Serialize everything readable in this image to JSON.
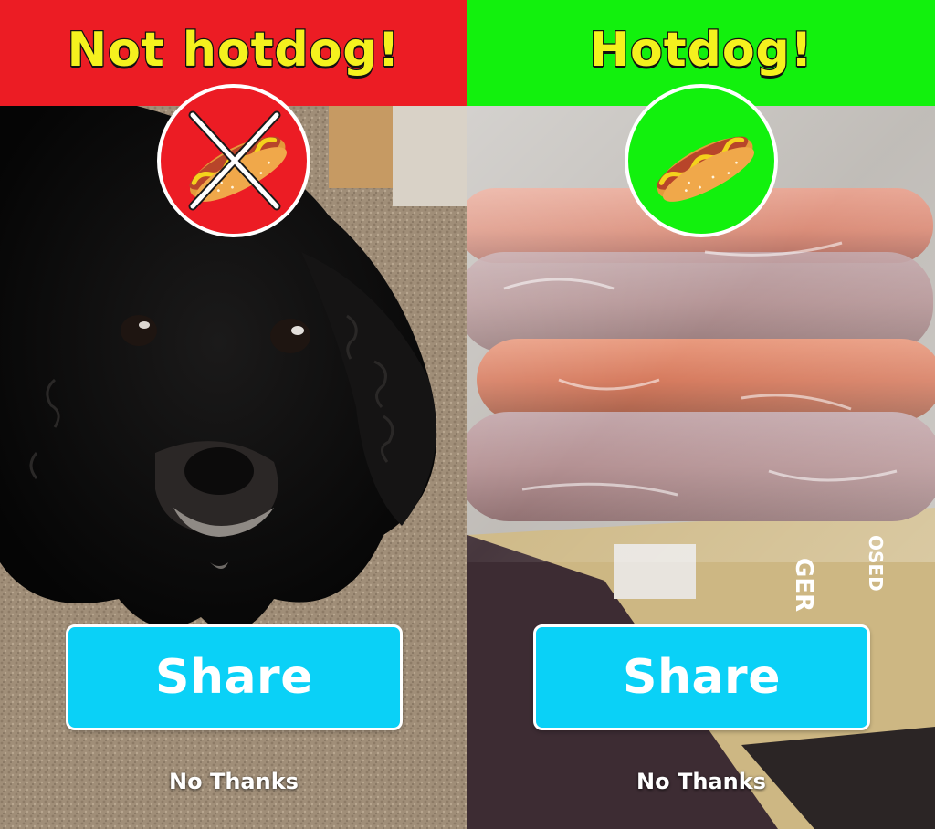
{
  "panels": [
    {
      "result": "not-hotdog",
      "banner_title": "Not hotdog!",
      "badge_icon": "hotdog-crossed-icon",
      "share_label": "Share",
      "dismiss_label": "No Thanks",
      "banner_color": "#ec1c24",
      "badge_color": "#ec1c24"
    },
    {
      "result": "hotdog",
      "banner_title": "Hotdog!",
      "badge_icon": "hotdog-icon",
      "share_label": "Share",
      "dismiss_label": "No Thanks",
      "banner_color": "#12f10d",
      "badge_color": "#12f10d"
    }
  ],
  "colors": {
    "title_text": "#f5f11e",
    "share_button": "#0ad1f7",
    "share_text": "#ffffff"
  },
  "photo_text": {
    "package_brand_partial": "GER",
    "package_label_partial": "OSED"
  }
}
